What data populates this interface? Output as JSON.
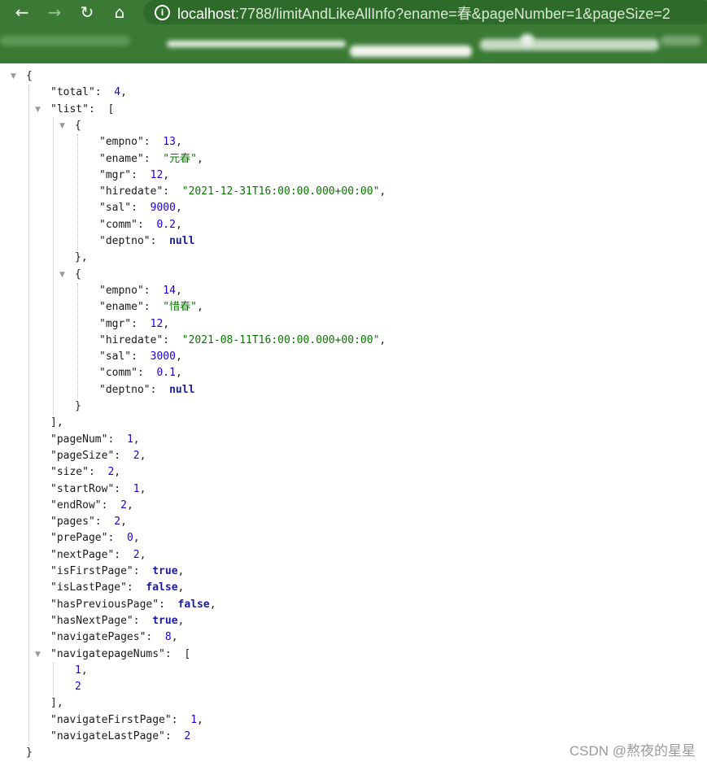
{
  "browser": {
    "url_host": "localhost",
    "url_rest": ":7788/limitAndLikeAllInfo?ename=春&pageNumber=1&pageSize=2",
    "colors": {
      "toolbar": "#3a7a34",
      "omnibox": "#2e6a29"
    },
    "icons": [
      "back-arrow-icon",
      "forward-arrow-icon",
      "reload-icon",
      "home-icon",
      "info-icon"
    ]
  },
  "json": {
    "total": "4",
    "list": [
      {
        "empno": "13",
        "ename": "\"元春\"",
        "mgr": "12",
        "hiredate": "\"2021-12-31T16:00:00.000+00:00\"",
        "sal": "9000",
        "comm": "0.2",
        "deptno": "null"
      },
      {
        "empno": "14",
        "ename": "\"惜春\"",
        "mgr": "12",
        "hiredate": "\"2021-08-11T16:00:00.000+00:00\"",
        "sal": "3000",
        "comm": "0.1",
        "deptno": "null"
      }
    ],
    "pageNum": "1",
    "pageSize": "2",
    "size": "2",
    "startRow": "1",
    "endRow": "2",
    "pages": "2",
    "prePage": "0",
    "nextPage": "2",
    "isFirstPage": "true",
    "isLastPage": "false",
    "hasPreviousPage": "false",
    "hasNextPage": "true",
    "navigatePages": "8",
    "navigatepageNums": [
      "1",
      "2"
    ],
    "navigateFirstPage": "1",
    "navigateLastPage": "2"
  },
  "keys": {
    "total": "\"total\"",
    "list": "\"list\"",
    "empno": "\"empno\"",
    "ename": "\"ename\"",
    "mgr": "\"mgr\"",
    "hiredate": "\"hiredate\"",
    "sal": "\"sal\"",
    "comm": "\"comm\"",
    "deptno": "\"deptno\"",
    "pageNum": "\"pageNum\"",
    "pageSize": "\"pageSize\"",
    "size": "\"size\"",
    "startRow": "\"startRow\"",
    "endRow": "\"endRow\"",
    "pages": "\"pages\"",
    "prePage": "\"prePage\"",
    "nextPage": "\"nextPage\"",
    "isFirstPage": "\"isFirstPage\"",
    "isLastPage": "\"isLastPage\"",
    "hasPreviousPage": "\"hasPreviousPage\"",
    "hasNextPage": "\"hasNextPage\"",
    "navigatePages": "\"navigatePages\"",
    "navigatepageNums": "\"navigatepageNums\"",
    "navigateFirstPage": "\"navigateFirstPage\"",
    "navigateLastPage": "\"navigateLastPage\""
  },
  "watermark": "CSDN @熬夜的星星"
}
